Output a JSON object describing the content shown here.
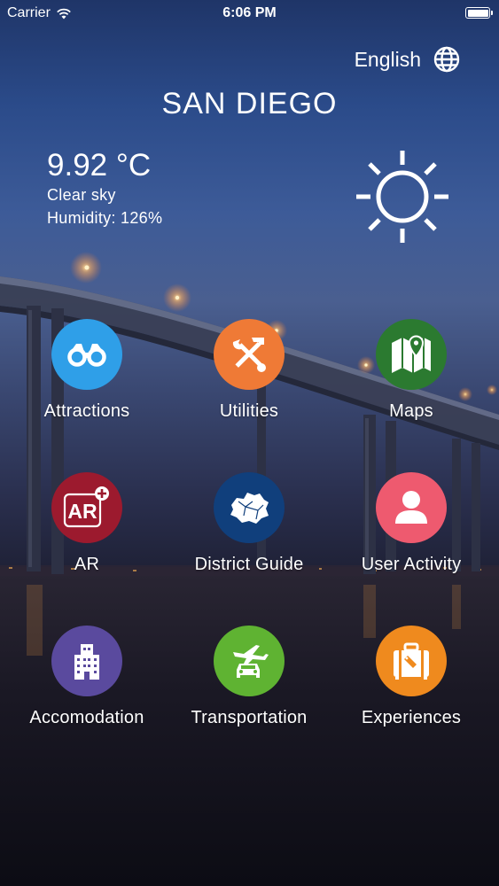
{
  "status_bar": {
    "carrier": "Carrier",
    "time": "6:06 PM"
  },
  "language": {
    "label": "English",
    "icon": "globe-icon"
  },
  "city": "SAN DIEGO",
  "weather": {
    "temperature": "9.92 °C",
    "condition": "Clear sky",
    "humidity": "Humidity: 126%",
    "icon": "sun-icon"
  },
  "menu": [
    {
      "label": "Attractions",
      "icon": "binoculars-icon",
      "color": "#2f9fe8"
    },
    {
      "label": "Utilities",
      "icon": "tools-icon",
      "color": "#ef7a36"
    },
    {
      "label": "Maps",
      "icon": "map-pin-icon",
      "color": "#2b7a30"
    },
    {
      "label": "AR",
      "icon": "ar-icon",
      "color": "#9c1a2e"
    },
    {
      "label": "District Guide",
      "icon": "district-map-icon",
      "color": "#103f7c"
    },
    {
      "label": "User Activity",
      "icon": "user-icon",
      "color": "#ee5a6f"
    },
    {
      "label": "Accomodation",
      "icon": "building-icon",
      "color": "#5a4a9e"
    },
    {
      "label": "Transportation",
      "icon": "plane-car-icon",
      "color": "#5fb332"
    },
    {
      "label": "Experiences",
      "icon": "suitcase-icon",
      "color": "#ef8a1e"
    }
  ]
}
